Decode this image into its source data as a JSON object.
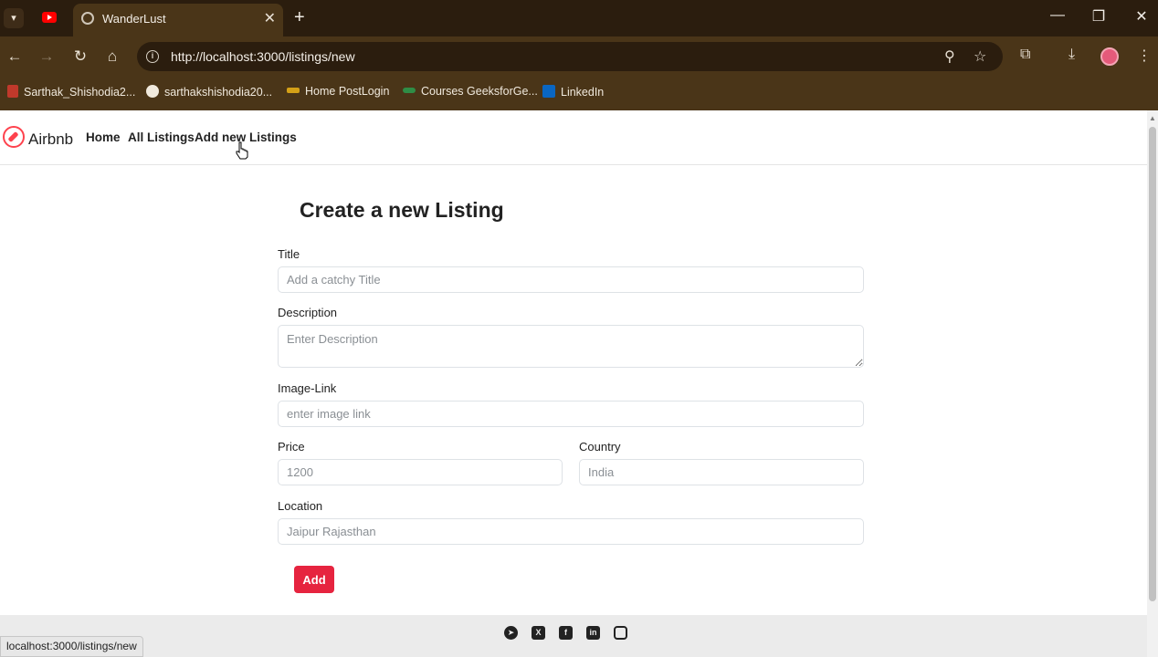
{
  "browser": {
    "tab_title": "WanderLust",
    "url": "http://localhost:3000/listings/new",
    "bookmarks": [
      {
        "label": "Sarthak_Shishodia2...",
        "icon": "wave-icon"
      },
      {
        "label": "sarthakshishodia20...",
        "icon": "github-icon"
      },
      {
        "label": "Home PostLogin",
        "icon": "site-icon"
      },
      {
        "label": "Courses GeeksforGe...",
        "icon": "geeksforgeeks-icon"
      },
      {
        "label": "LinkedIn",
        "icon": "linkedin-icon"
      }
    ],
    "status_url": "localhost:3000/listings/new"
  },
  "navbar": {
    "brand": "Airbnb",
    "links": [
      "Home",
      "All Listings",
      "Add new Listings"
    ]
  },
  "form": {
    "heading": "Create a new Listing",
    "title_label": "Title",
    "title_placeholder": "Add a catchy Title",
    "description_label": "Description",
    "description_placeholder": "Enter Description",
    "image_label": "Image-Link",
    "image_placeholder": "enter image link",
    "price_label": "Price",
    "price_placeholder": "1200",
    "country_label": "Country",
    "country_placeholder": "India",
    "location_label": "Location",
    "location_placeholder": "Jaipur Rajasthan",
    "submit_label": "Add"
  },
  "footer": {
    "social_icons": [
      "telegram-icon",
      "x-icon",
      "facebook-icon",
      "linkedin-icon",
      "instagram-icon"
    ]
  },
  "colors": {
    "brand": "#fe424d",
    "button": "#e6243f",
    "browser_frame": "#4a3518"
  }
}
